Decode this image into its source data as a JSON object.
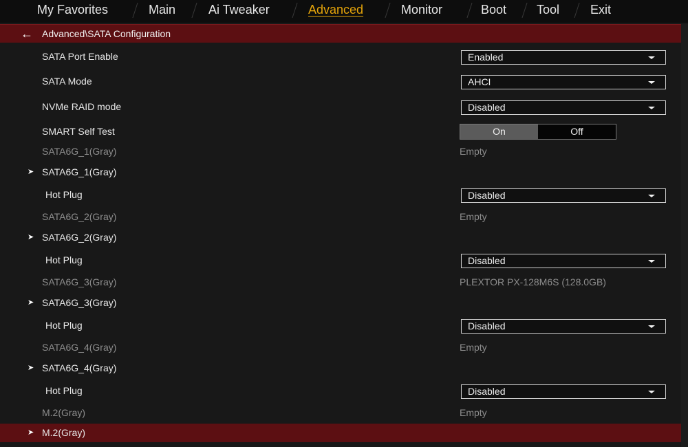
{
  "nav": {
    "tabs": [
      "My Favorites",
      "Main",
      "Ai Tweaker",
      "Advanced",
      "Monitor",
      "Boot",
      "Tool",
      "Exit"
    ],
    "active": "Advanced"
  },
  "breadcrumb": {
    "back_icon": "arrow-left-icon",
    "path": "Advanced\\SATA Configuration"
  },
  "settings": {
    "sata_port_enable": {
      "label": "SATA Port Enable",
      "value": "Enabled"
    },
    "sata_mode": {
      "label": "SATA Mode",
      "value": "AHCI"
    },
    "nvme_raid_mode": {
      "label": "NVMe RAID mode",
      "value": "Disabled"
    },
    "smart_self_test": {
      "label": "SMART Self Test",
      "on_label": "On",
      "off_label": "Off",
      "selected": "On"
    }
  },
  "ports": [
    {
      "info_label": "SATA6G_1(Gray)",
      "info_value": "Empty",
      "submenu_label": "SATA6G_1(Gray)",
      "hot_plug_label": "Hot Plug",
      "hot_plug_value": "Disabled"
    },
    {
      "info_label": "SATA6G_2(Gray)",
      "info_value": "Empty",
      "submenu_label": "SATA6G_2(Gray)",
      "hot_plug_label": "Hot Plug",
      "hot_plug_value": "Disabled"
    },
    {
      "info_label": "SATA6G_3(Gray)",
      "info_value": "PLEXTOR PX-128M6S (128.0GB)",
      "submenu_label": "SATA6G_3(Gray)",
      "hot_plug_label": "Hot Plug",
      "hot_plug_value": "Disabled"
    },
    {
      "info_label": "SATA6G_4(Gray)",
      "info_value": "Empty",
      "submenu_label": "SATA6G_4(Gray)",
      "hot_plug_label": "Hot Plug",
      "hot_plug_value": "Disabled"
    }
  ],
  "m2": {
    "info_label": "M.2(Gray)",
    "info_value": "Empty",
    "submenu_label": "M.2(Gray)"
  },
  "icons": {
    "submenu_arrow": "submenu-arrow-icon",
    "dropdown_caret": "chevron-down-icon"
  },
  "colors": {
    "accent": "#e5a40a",
    "highlight": "#5c0f12",
    "background": "#181818"
  }
}
